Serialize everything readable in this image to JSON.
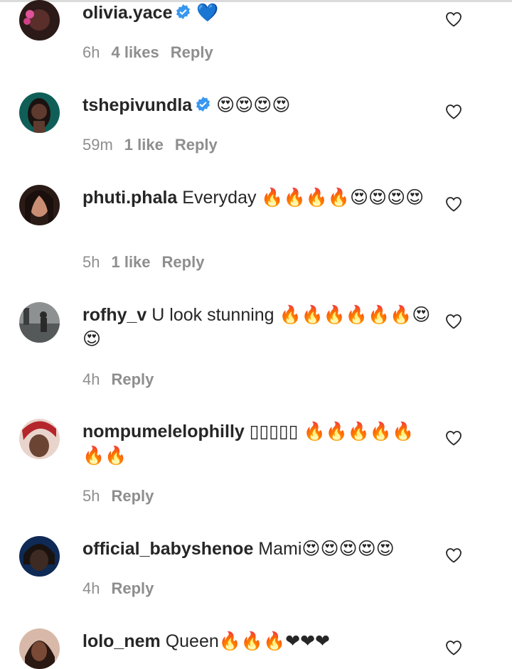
{
  "comments": [
    {
      "username": "olivia.yace",
      "verified": true,
      "text": " 💙",
      "time": "6h",
      "likes": "4 likes",
      "reply": "Reply",
      "avatar_color": "#5a2e2a",
      "avatar_accent": "#e0529c"
    },
    {
      "username": "tshepivundla",
      "verified": true,
      "text": " 😍😍😍😍",
      "time": "59m",
      "likes": "1 like",
      "reply": "Reply",
      "avatar_color": "#3a2620",
      "avatar_accent": "#0f5f58"
    },
    {
      "username": "phuti.phala",
      "verified": false,
      "text": " Everyday 🔥🔥🔥🔥😍😍😍😍",
      "time": "5h",
      "likes": "1 like",
      "reply": "Reply",
      "avatar_color": "#2b1b17",
      "avatar_accent": "#c98d74"
    },
    {
      "username": "rofhy_v",
      "verified": false,
      "text": " U look stunning 🔥🔥🔥🔥🔥🔥😍😍",
      "time": "4h",
      "likes": "",
      "reply": "Reply",
      "avatar_color": "#6b6f70",
      "avatar_accent": "#2a2a2a"
    },
    {
      "username": "nompumelelophilly",
      "verified": false,
      "text": " ▯▯▯▯▯ 🔥🔥🔥🔥🔥🔥🔥",
      "time": "5h",
      "likes": "",
      "reply": "Reply",
      "avatar_color": "#e9d4cc",
      "avatar_accent": "#b5252c"
    },
    {
      "username": "official_babyshenoe",
      "verified": false,
      "text": " Mami😍😍😍😍😍",
      "time": "4h",
      "likes": "",
      "reply": "Reply",
      "avatar_color": "#3d2a22",
      "avatar_accent": "#0e2a55"
    },
    {
      "username": "lolo_nem",
      "verified": false,
      "text": " Queen🔥🔥🔥❤❤❤",
      "time": "",
      "likes": "",
      "reply": "",
      "avatar_color": "#4a2c22",
      "avatar_accent": "#d8b8a8"
    }
  ],
  "colors": {
    "verified_blue": "#3897f0",
    "meta_gray": "#8e8e8e",
    "text_dark": "#262626"
  }
}
